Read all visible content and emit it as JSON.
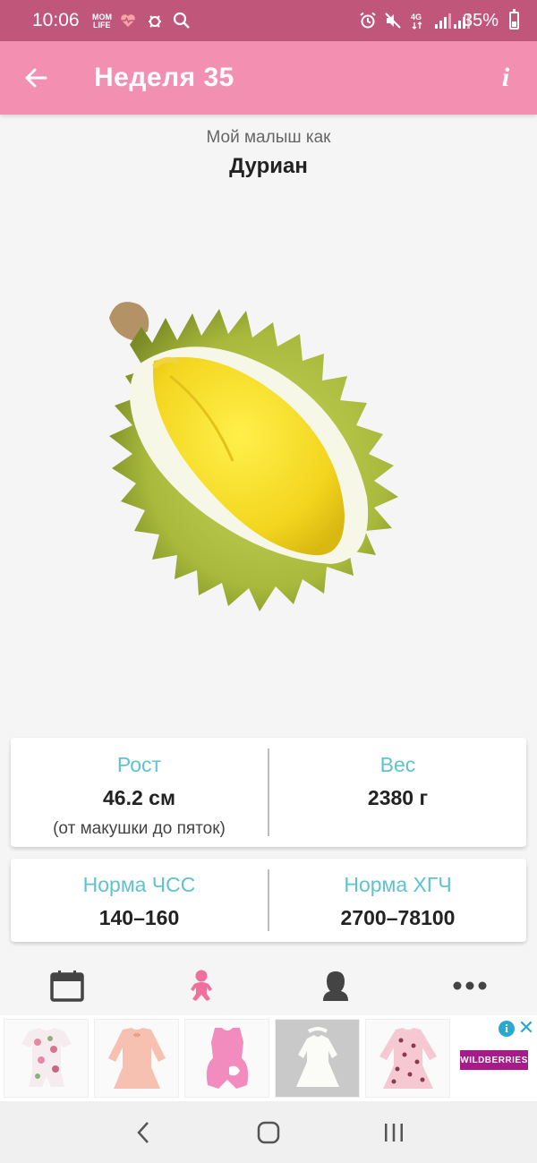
{
  "status_bar": {
    "time": "10:06",
    "battery": "35%",
    "network": "4G",
    "icons": [
      "momlife-icon",
      "heart-pulse-icon",
      "bug-icon",
      "search-icon",
      "alarm-icon",
      "mute-icon",
      "signal-icon",
      "battery-icon"
    ],
    "color": "#c0577a"
  },
  "app_bar": {
    "title": "Неделя 35",
    "info_label": "i",
    "color": "#f38fb0"
  },
  "fruit": {
    "subtitle": "Мой малыш как",
    "name": "Дуриан"
  },
  "stats": {
    "height_label": "Рост",
    "height_value": "46.2 см",
    "height_note": "(от макушки до пяток)",
    "weight_label": "Вес",
    "weight_value": "2380 г",
    "hr_label": "Норма ЧСС",
    "hr_value": "140–160",
    "hcg_label": "Норма ХГЧ",
    "hcg_value": "2700–78100",
    "label_color": "#5ec3cf"
  },
  "bottom_nav": {
    "items": [
      "calendar-icon",
      "baby-icon",
      "mother-icon",
      "more-icon"
    ],
    "active": "baby-icon",
    "active_color": "#f06f9c",
    "inactive_color": "#444444"
  },
  "ad": {
    "brand": "WILDBERRIES",
    "info": "i",
    "close": "✕",
    "products": [
      "floral-romper",
      "peach-dress",
      "pink-bodysuit",
      "white-dress",
      "leopard-dress"
    ]
  },
  "system_nav": {
    "back": "back-icon",
    "home": "home-icon",
    "recents": "recents-icon"
  }
}
